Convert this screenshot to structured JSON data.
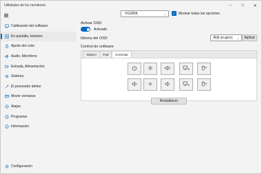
{
  "window": {
    "title": "Utilidades de los monitores"
  },
  "sidebar": {
    "items": [
      {
        "label": "Calibración del software",
        "icon": "calibration-icon"
      },
      {
        "label": "En pantalla, botones",
        "icon": "onscreen-buttons-icon"
      },
      {
        "label": "Ajuste del color",
        "icon": "color-adjust-icon"
      },
      {
        "label": "Audio, Micrófono",
        "icon": "audio-icon"
      },
      {
        "label": "Entrada, Alimentación",
        "icon": "input-power-icon"
      },
      {
        "label": "Sistema",
        "icon": "system-icon"
      },
      {
        "label": "El proveedor define",
        "icon": "vendor-icon"
      },
      {
        "label": "Mover ventanas",
        "icon": "move-windows-icon"
      },
      {
        "label": "Atajos",
        "icon": "shortcuts-icon"
      },
      {
        "label": "Programar",
        "icon": "schedule-icon"
      },
      {
        "label": "Información",
        "icon": "info-icon"
      }
    ],
    "active_index": 1,
    "settings_label": "Configuración"
  },
  "header": {
    "monitor": "VG280K",
    "show_all_label": "Mostrar todas las opciones",
    "show_all_checked": true
  },
  "osd": {
    "activate_label": "Activar OSD",
    "toggle_label": "Activado",
    "toggle_on": true,
    "language_label": "Idioma del OSD",
    "language_value": "英語 (English)",
    "apply_label": "Aplicar",
    "software_control_label": "Control de software"
  },
  "tabs": [
    {
      "label": "Básico"
    },
    {
      "label": "Pad"
    },
    {
      "label": "Controlar"
    }
  ],
  "active_tab": 2,
  "controls": [
    {
      "icon": "power-icon"
    },
    {
      "icon": "brightness-up-icon"
    },
    {
      "icon": "volume-up-icon"
    },
    {
      "icon": "input-next-icon"
    },
    {
      "icon": "mouse-up-icon"
    },
    {
      "icon": "mute-icon"
    },
    {
      "icon": "brightness-down-icon"
    },
    {
      "icon": "volume-down-icon"
    },
    {
      "icon": "input-prev-icon"
    },
    {
      "icon": "mouse-down-icon"
    }
  ],
  "reset_label": "Restablecer",
  "colors": {
    "accent": "#0067c0"
  }
}
